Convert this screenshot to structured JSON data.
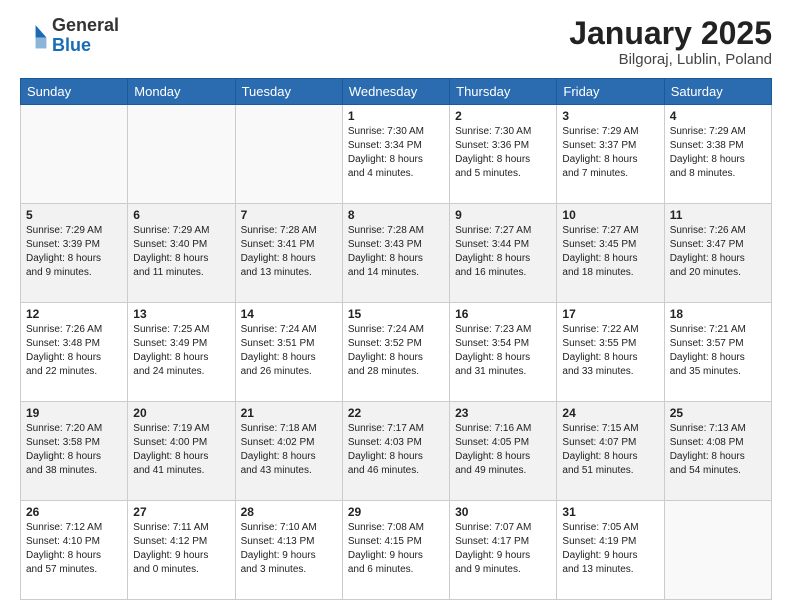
{
  "header": {
    "logo_general": "General",
    "logo_blue": "Blue",
    "title": "January 2025",
    "location": "Bilgoraj, Lublin, Poland"
  },
  "weekdays": [
    "Sunday",
    "Monday",
    "Tuesday",
    "Wednesday",
    "Thursday",
    "Friday",
    "Saturday"
  ],
  "weeks": [
    [
      {
        "day": "",
        "info": ""
      },
      {
        "day": "",
        "info": ""
      },
      {
        "day": "",
        "info": ""
      },
      {
        "day": "1",
        "info": "Sunrise: 7:30 AM\nSunset: 3:34 PM\nDaylight: 8 hours\nand 4 minutes."
      },
      {
        "day": "2",
        "info": "Sunrise: 7:30 AM\nSunset: 3:36 PM\nDaylight: 8 hours\nand 5 minutes."
      },
      {
        "day": "3",
        "info": "Sunrise: 7:29 AM\nSunset: 3:37 PM\nDaylight: 8 hours\nand 7 minutes."
      },
      {
        "day": "4",
        "info": "Sunrise: 7:29 AM\nSunset: 3:38 PM\nDaylight: 8 hours\nand 8 minutes."
      }
    ],
    [
      {
        "day": "5",
        "info": "Sunrise: 7:29 AM\nSunset: 3:39 PM\nDaylight: 8 hours\nand 9 minutes."
      },
      {
        "day": "6",
        "info": "Sunrise: 7:29 AM\nSunset: 3:40 PM\nDaylight: 8 hours\nand 11 minutes."
      },
      {
        "day": "7",
        "info": "Sunrise: 7:28 AM\nSunset: 3:41 PM\nDaylight: 8 hours\nand 13 minutes."
      },
      {
        "day": "8",
        "info": "Sunrise: 7:28 AM\nSunset: 3:43 PM\nDaylight: 8 hours\nand 14 minutes."
      },
      {
        "day": "9",
        "info": "Sunrise: 7:27 AM\nSunset: 3:44 PM\nDaylight: 8 hours\nand 16 minutes."
      },
      {
        "day": "10",
        "info": "Sunrise: 7:27 AM\nSunset: 3:45 PM\nDaylight: 8 hours\nand 18 minutes."
      },
      {
        "day": "11",
        "info": "Sunrise: 7:26 AM\nSunset: 3:47 PM\nDaylight: 8 hours\nand 20 minutes."
      }
    ],
    [
      {
        "day": "12",
        "info": "Sunrise: 7:26 AM\nSunset: 3:48 PM\nDaylight: 8 hours\nand 22 minutes."
      },
      {
        "day": "13",
        "info": "Sunrise: 7:25 AM\nSunset: 3:49 PM\nDaylight: 8 hours\nand 24 minutes."
      },
      {
        "day": "14",
        "info": "Sunrise: 7:24 AM\nSunset: 3:51 PM\nDaylight: 8 hours\nand 26 minutes."
      },
      {
        "day": "15",
        "info": "Sunrise: 7:24 AM\nSunset: 3:52 PM\nDaylight: 8 hours\nand 28 minutes."
      },
      {
        "day": "16",
        "info": "Sunrise: 7:23 AM\nSunset: 3:54 PM\nDaylight: 8 hours\nand 31 minutes."
      },
      {
        "day": "17",
        "info": "Sunrise: 7:22 AM\nSunset: 3:55 PM\nDaylight: 8 hours\nand 33 minutes."
      },
      {
        "day": "18",
        "info": "Sunrise: 7:21 AM\nSunset: 3:57 PM\nDaylight: 8 hours\nand 35 minutes."
      }
    ],
    [
      {
        "day": "19",
        "info": "Sunrise: 7:20 AM\nSunset: 3:58 PM\nDaylight: 8 hours\nand 38 minutes."
      },
      {
        "day": "20",
        "info": "Sunrise: 7:19 AM\nSunset: 4:00 PM\nDaylight: 8 hours\nand 41 minutes."
      },
      {
        "day": "21",
        "info": "Sunrise: 7:18 AM\nSunset: 4:02 PM\nDaylight: 8 hours\nand 43 minutes."
      },
      {
        "day": "22",
        "info": "Sunrise: 7:17 AM\nSunset: 4:03 PM\nDaylight: 8 hours\nand 46 minutes."
      },
      {
        "day": "23",
        "info": "Sunrise: 7:16 AM\nSunset: 4:05 PM\nDaylight: 8 hours\nand 49 minutes."
      },
      {
        "day": "24",
        "info": "Sunrise: 7:15 AM\nSunset: 4:07 PM\nDaylight: 8 hours\nand 51 minutes."
      },
      {
        "day": "25",
        "info": "Sunrise: 7:13 AM\nSunset: 4:08 PM\nDaylight: 8 hours\nand 54 minutes."
      }
    ],
    [
      {
        "day": "26",
        "info": "Sunrise: 7:12 AM\nSunset: 4:10 PM\nDaylight: 8 hours\nand 57 minutes."
      },
      {
        "day": "27",
        "info": "Sunrise: 7:11 AM\nSunset: 4:12 PM\nDaylight: 9 hours\nand 0 minutes."
      },
      {
        "day": "28",
        "info": "Sunrise: 7:10 AM\nSunset: 4:13 PM\nDaylight: 9 hours\nand 3 minutes."
      },
      {
        "day": "29",
        "info": "Sunrise: 7:08 AM\nSunset: 4:15 PM\nDaylight: 9 hours\nand 6 minutes."
      },
      {
        "day": "30",
        "info": "Sunrise: 7:07 AM\nSunset: 4:17 PM\nDaylight: 9 hours\nand 9 minutes."
      },
      {
        "day": "31",
        "info": "Sunrise: 7:05 AM\nSunset: 4:19 PM\nDaylight: 9 hours\nand 13 minutes."
      },
      {
        "day": "",
        "info": ""
      }
    ]
  ]
}
